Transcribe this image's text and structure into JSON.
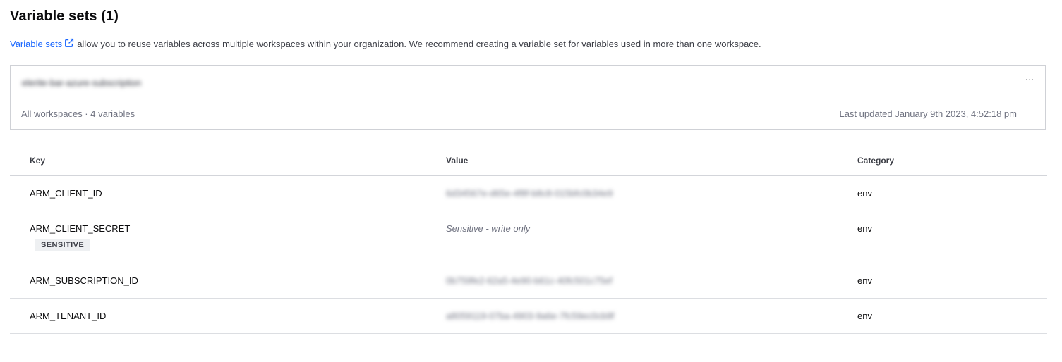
{
  "page": {
    "title": "Variable sets (1)",
    "intro_link": "Variable sets",
    "intro_text": "allow you to reuse variables across multiple workspaces within your organization. We recommend creating a variable set for variables used in more than one workspace."
  },
  "variable_set": {
    "name": "elerite-bar-azure-subscription",
    "menu_label": "···",
    "meta": "All workspaces · 4 variables",
    "last_updated": "Last updated January 9th 2023, 4:52:18 pm"
  },
  "table": {
    "headers": {
      "key": "Key",
      "value": "Value",
      "category": "Category"
    },
    "rows": [
      {
        "key": "ARM_CLIENT_ID",
        "value": "6d34567e-d65e-4f8f-b8c8-015bfc0b34e9",
        "category": "env"
      },
      {
        "key": "ARM_CLIENT_SECRET",
        "value": "Sensitive - write only",
        "badge": "SENSITIVE",
        "category": "env"
      },
      {
        "key": "ARM_SUBSCRIPTION_ID",
        "value": "0b759fe2-62a5-4e90-b61c-40fc501c75ef",
        "category": "env"
      },
      {
        "key": "ARM_TENANT_ID",
        "value": "a8059119-07ba-4903-9a6e-7fc59ec0cb9f",
        "category": "env"
      }
    ]
  },
  "colors": {
    "link": "#1563ff",
    "border": "#cfd1d6",
    "muted_text": "#6f7280"
  },
  "icons": {
    "external_link": "external-link-icon",
    "more": "more-horizontal-icon"
  }
}
